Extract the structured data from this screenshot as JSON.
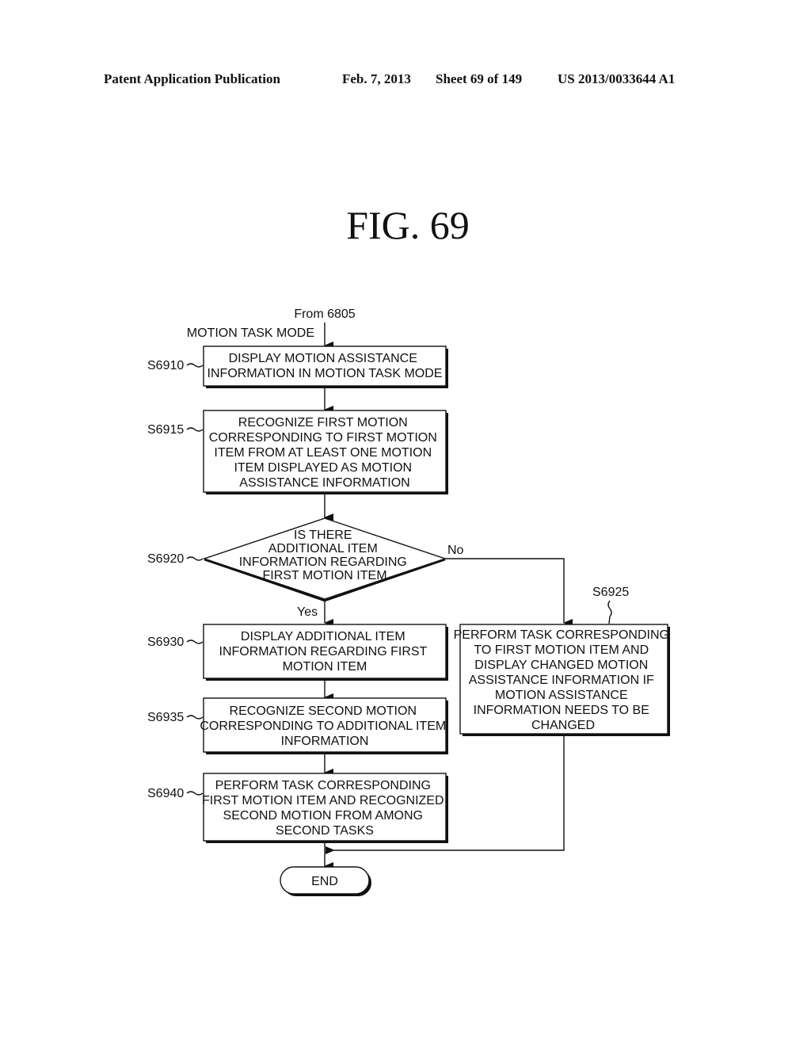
{
  "header": {
    "publication": "Patent Application Publication",
    "date": "Feb. 7, 2013",
    "sheet": "Sheet 69 of 149",
    "number": "US 2013/0033644 A1"
  },
  "figure_title": "FIG.  69",
  "flowchart": {
    "entry_from": "From 6805",
    "entry_mode": "MOTION TASK MODE",
    "steps": {
      "s6910": {
        "id": "S6910",
        "lines": [
          "DISPLAY MOTION ASSISTANCE",
          "INFORMATION IN MOTION TASK MODE"
        ]
      },
      "s6915": {
        "id": "S6915",
        "lines": [
          "RECOGNIZE FIRST MOTION",
          "CORRESPONDING TO FIRST MOTION",
          "ITEM FROM AT LEAST ONE MOTION",
          "ITEM DISPLAYED AS MOTION",
          "ASSISTANCE INFORMATION"
        ]
      },
      "s6920": {
        "id": "S6920",
        "lines": [
          "IS THERE",
          "ADDITIONAL ITEM",
          "INFORMATION REGARDING",
          "FIRST MOTION ITEM"
        ],
        "yes": "Yes",
        "no": "No"
      },
      "s6925": {
        "id": "S6925",
        "lines": [
          "PERFORM TASK CORRESPONDING",
          "TO FIRST MOTION ITEM AND",
          "DISPLAY CHANGED MOTION",
          "ASSISTANCE INFORMATION IF",
          "MOTION ASSISTANCE",
          "INFORMATION NEEDS TO BE",
          "CHANGED"
        ]
      },
      "s6930": {
        "id": "S6930",
        "lines": [
          "DISPLAY ADDITIONAL ITEM",
          "INFORMATION REGARDING FIRST",
          "MOTION ITEM"
        ]
      },
      "s6935": {
        "id": "S6935",
        "lines": [
          "RECOGNIZE SECOND MOTION",
          "CORRESPONDING TO ADDITIONAL ITEM",
          "INFORMATION"
        ]
      },
      "s6940": {
        "id": "S6940",
        "lines": [
          "PERFORM TASK CORRESPONDING",
          "FIRST MOTION ITEM AND RECOGNIZED",
          "SECOND MOTION FROM AMONG",
          "SECOND TASKS"
        ]
      }
    },
    "end_label": "END"
  }
}
